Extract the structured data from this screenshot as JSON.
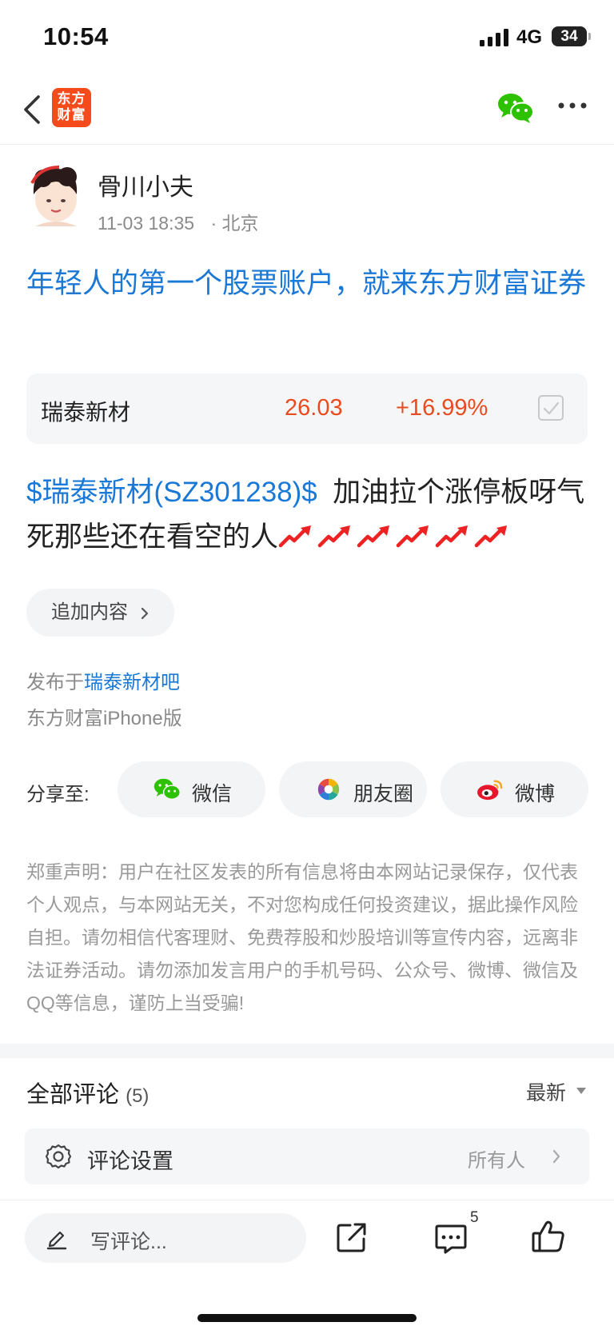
{
  "status_bar": {
    "time": "10:54",
    "network": "4G",
    "battery": "34"
  },
  "nav": {
    "logo_text": "东方财富",
    "back_icon": "chevron-left-icon",
    "wechat_icon": "wechat-icon",
    "more_icon": "more-horizontal-icon"
  },
  "author": {
    "name": "骨川小夫",
    "date": "11-03 18:35",
    "location": "· 北京"
  },
  "post": {
    "title": "年轻人的第一个股票账户，就来东方财富证券",
    "stock": {
      "name": "瑞泰新材",
      "price": "26.03",
      "change": "+16.99%"
    },
    "tag": "$瑞泰新材(SZ301238)$",
    "text": "加油拉个涨停板呀气死那些还在看空的人",
    "trend_icons": 6
  },
  "append_button": "追加内容",
  "published": {
    "prefix": "发布于",
    "bar": "瑞泰新材吧"
  },
  "client": "东方财富iPhone版",
  "share": {
    "label": "分享至:",
    "buttons": [
      {
        "label": "微信",
        "icon": "wechat-icon"
      },
      {
        "label": "朋友圈",
        "icon": "moments-icon"
      },
      {
        "label": "微博",
        "icon": "weibo-icon"
      }
    ]
  },
  "disclaimer": "郑重声明：用户在社区发表的所有信息将由本网站记录保存，仅代表个人观点，与本网站无关，不对您构成任何投资建议，据此操作风险自担。请勿相信代客理财、免费荐股和炒股培训等宣传内容，远离非法证券活动。请勿添加发言用户的手机号码、公众号、微博、微信及QQ等信息，谨防上当受骗!",
  "comments": {
    "title": "全部评论",
    "count": "(5)",
    "sort": "最新",
    "settings_label": "评论设置",
    "settings_value": "所有人"
  },
  "bottom_bar": {
    "placeholder": "写评论...",
    "comment_badge": "5"
  },
  "colors": {
    "link_blue": "#1a78d6",
    "stock_red": "#e84c1e",
    "brand_orange": "#f54a1c",
    "wechat_green": "#2dc100"
  }
}
